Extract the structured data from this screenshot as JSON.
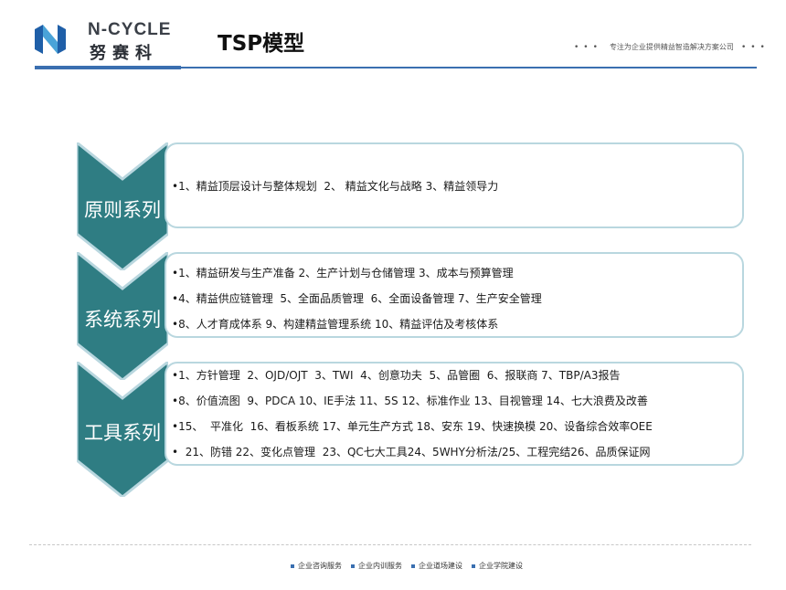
{
  "brand": {
    "name_en": "N-CYCLE",
    "name_cn": "努赛科"
  },
  "page_title": "TSP模型",
  "slogan": "专注为企业提供精益智造解决方案公司",
  "colors": {
    "chevron": "#2f7d83",
    "box_border": "#b9d7df",
    "accent": "#3a6fb0"
  },
  "sections": [
    {
      "label": "原则系列",
      "lines": [
        "•1、精益顶层设计与整体规划  2、 精益文化与战略 3、精益领导力"
      ]
    },
    {
      "label": "系统系列",
      "lines": [
        "•1、精益研发与生产准备 2、生产计划与仓储管理 3、成本与预算管理",
        "•4、精益供应链管理  5、全面品质管理  6、全面设备管理 7、生产安全管理",
        "•8、人才育成体系 9、构建精益管理系统 10、精益评估及考核体系"
      ]
    },
    {
      "label": "工具系列",
      "lines": [
        "•1、方针管理  2、OJD/OJT  3、TWI  4、创意功夫  5、品管圈  6、报联商 7、TBP/A3报告",
        "•8、价值流图  9、PDCA 10、IE手法 11、5S 12、标准作业 13、目视管理 14、七大浪费及改善",
        "•15、  平准化  16、看板系统 17、单元生产方式 18、安东 19、快速换模 20、设备综合效率OEE",
        "•  21、防错 22、变化点管理  23、QC七大工具24、5WHY分析法/25、工程完结26、品质保证网"
      ]
    }
  ],
  "footer": {
    "links": [
      "企业咨询服务",
      "企业内训服务",
      "企业道场建设",
      "企业学院建设"
    ]
  }
}
